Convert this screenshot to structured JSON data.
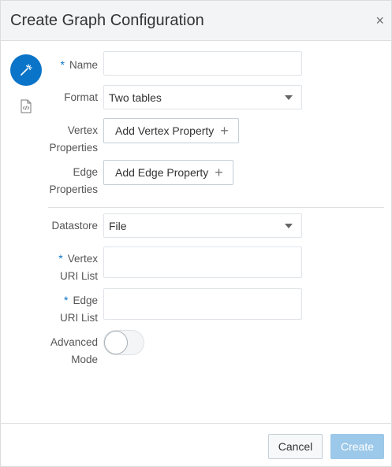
{
  "dialog": {
    "title": "Create Graph Configuration",
    "close_glyph": "×"
  },
  "sidebar": {
    "items": [
      {
        "icon": "wand-icon",
        "active": true
      },
      {
        "icon": "code-file-icon",
        "active": false
      }
    ]
  },
  "form": {
    "name": {
      "label": "Name",
      "required": "*",
      "value": ""
    },
    "format": {
      "label": "Format",
      "value": "Two tables"
    },
    "vertex_properties": {
      "label_line1": "Vertex",
      "label_line2": "Properties",
      "button": "Add Vertex Property",
      "plus": "+"
    },
    "edge_properties": {
      "label_line1": "Edge",
      "label_line2": "Properties",
      "button": "Add Edge Property",
      "plus": "+"
    },
    "datastore": {
      "label": "Datastore",
      "value": "File"
    },
    "vertex_uri_list": {
      "label_line1": "Vertex",
      "label_line2": "URI List",
      "required": "*",
      "value": ""
    },
    "edge_uri_list": {
      "label_line1": "Edge",
      "label_line2": "URI List",
      "required": "*",
      "value": ""
    },
    "advanced_mode": {
      "label_line1": "Advanced",
      "label_line2": "Mode",
      "on": false
    }
  },
  "footer": {
    "cancel_label": "Cancel",
    "create_label": "Create"
  },
  "colors": {
    "accent": "#0a74c8",
    "create_disabled": "#9cc8e9",
    "header_bg": "#f3f4f5"
  }
}
